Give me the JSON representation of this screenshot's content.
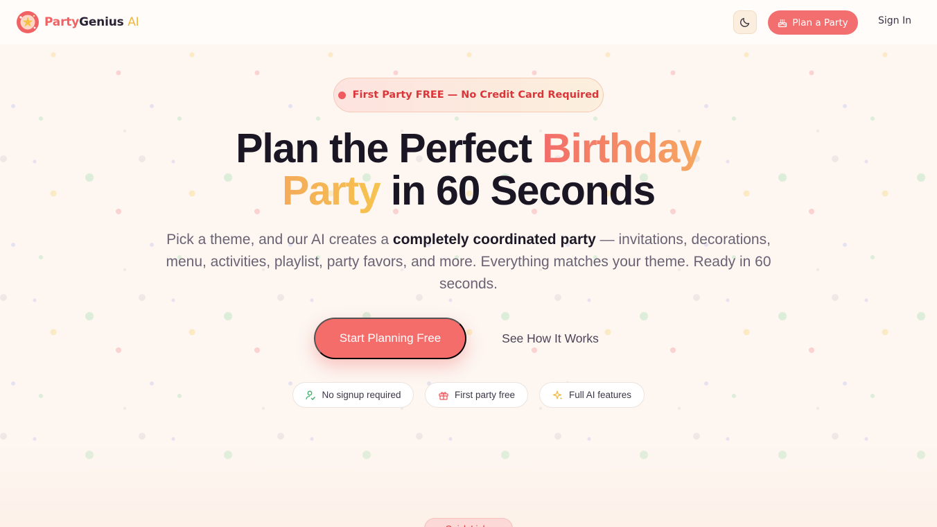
{
  "brand": {
    "name_part1": "Party",
    "name_part2": "Genius",
    "name_part3": "AI",
    "logo_icon": "party-popper-icon"
  },
  "nav": {
    "theme_toggle_icon": "moon-icon",
    "plan_label": "Plan a Party",
    "plan_icon": "cake-icon",
    "signin_label": "Sign In"
  },
  "badge": {
    "text": "First Party FREE — No Credit Card Required"
  },
  "headline": {
    "part1": "Plan the Perfect ",
    "highlight1": "Birthday",
    "highlight2": "Party",
    "part2": " in 60 Seconds"
  },
  "subheadline": {
    "part1": "Pick a theme, and our AI creates a ",
    "bold": "completely coordinated party",
    "part2": " — invitations, decorations, menu, activities, playlist, party favors, and more. Everything matches your theme. Ready in 60 seconds."
  },
  "cta": {
    "primary": "Start Planning Free",
    "secondary": "See How It Works"
  },
  "features": [
    {
      "label": "No signup required",
      "icon": "user-check-icon"
    },
    {
      "label": "First party free",
      "icon": "gift-icon"
    },
    {
      "label": "Full AI features",
      "icon": "sparkle-icon"
    }
  ],
  "next_section_badge": {
    "text": "Quick Links"
  },
  "colors": {
    "accent": "#f36f6f",
    "accent_dark": "#d9363a",
    "gold": "#f2b63e",
    "background": "#fdf6f1",
    "text": "#1b1624"
  }
}
